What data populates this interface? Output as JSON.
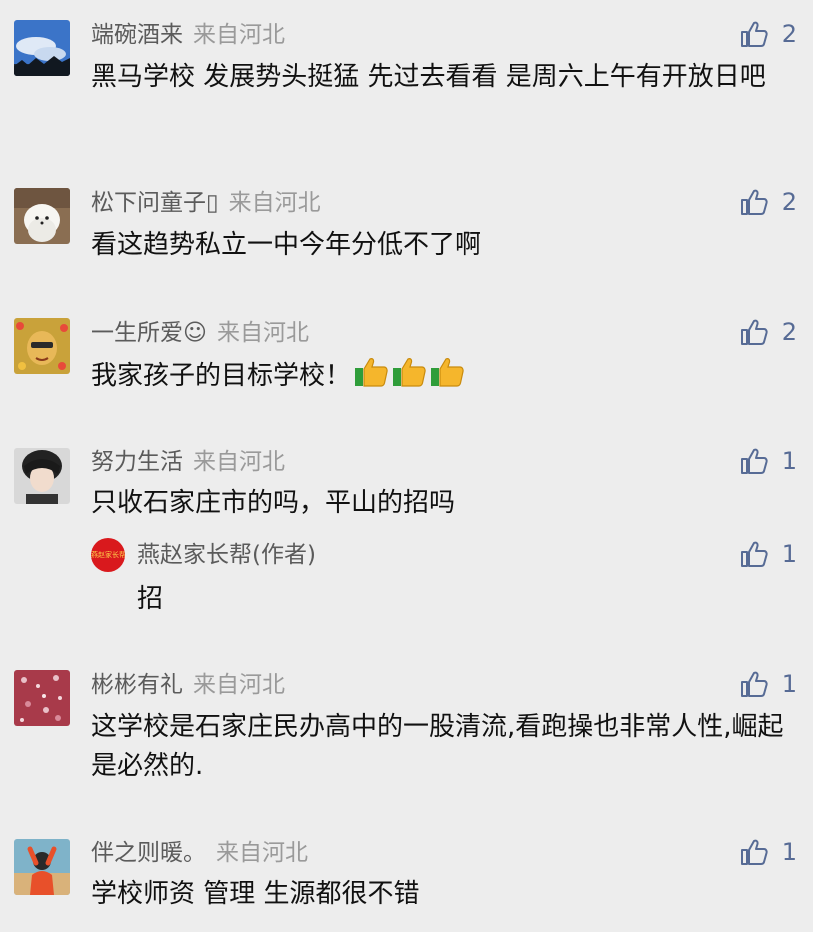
{
  "comments": [
    {
      "nickname": "端碗酒来",
      "location": "来自河北",
      "likes": "2",
      "text": "黑马学校  发展势头挺猛  先过去看看  是周六上午有开放日吧"
    },
    {
      "nickname": "松下问童子▯",
      "location": "来自河北",
      "likes": "2",
      "text": "看这趋势私立一中今年分低不了啊"
    },
    {
      "nickname": "一生所爱☺",
      "location": "来自河北",
      "likes": "2",
      "text": "我家孩子的目标学校！"
    },
    {
      "nickname": "努力生活",
      "location": "来自河北",
      "likes": "1",
      "text": "只收石家庄市的吗，平山的招吗",
      "reply": {
        "nickname": "燕赵家长帮(作者)",
        "avatar_text": "燕赵家长帮",
        "likes": "1",
        "text": "招"
      }
    },
    {
      "nickname": "彬彬有礼",
      "location": "来自河北",
      "likes": "1",
      "text": "这学校是石家庄民办高中的一股清流,看跑操也非常人性,崛起是必然的."
    },
    {
      "nickname": "伴之则暖。",
      "location": "来自河北",
      "likes": "1",
      "text": "学校师资  管理  生源都很不错"
    }
  ],
  "colors": {
    "background": "#ededed",
    "like_icon": "#576b95",
    "nickname": "#5b5b5b",
    "location": "#9a9a9a",
    "author_badge": "#d9191d"
  },
  "icons": {
    "like": "thumbs-up-outline-icon",
    "emoji": "thumbs-up-emoji-icon"
  }
}
